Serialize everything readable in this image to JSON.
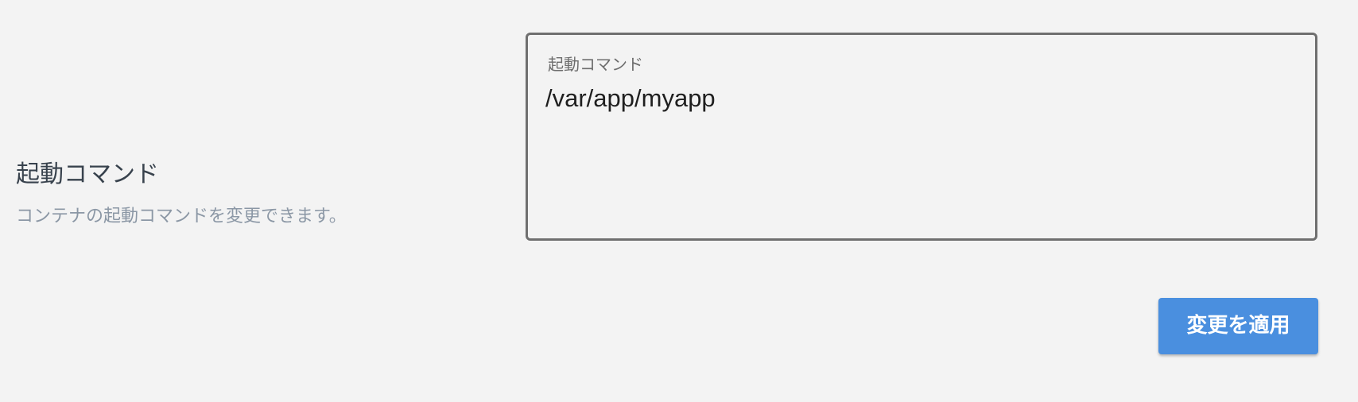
{
  "setting": {
    "title": "起動コマンド",
    "description": "コンテナの起動コマンドを変更できます。"
  },
  "command_field": {
    "label": "起動コマンド",
    "value": "/var/app/myapp"
  },
  "actions": {
    "apply_label": "変更を適用"
  },
  "colors": {
    "background": "#f3f3f3",
    "primary_button": "#4a8fdf",
    "field_border": "#6f6f6f",
    "title_text": "#38424d",
    "description_text": "#8b97a5"
  }
}
